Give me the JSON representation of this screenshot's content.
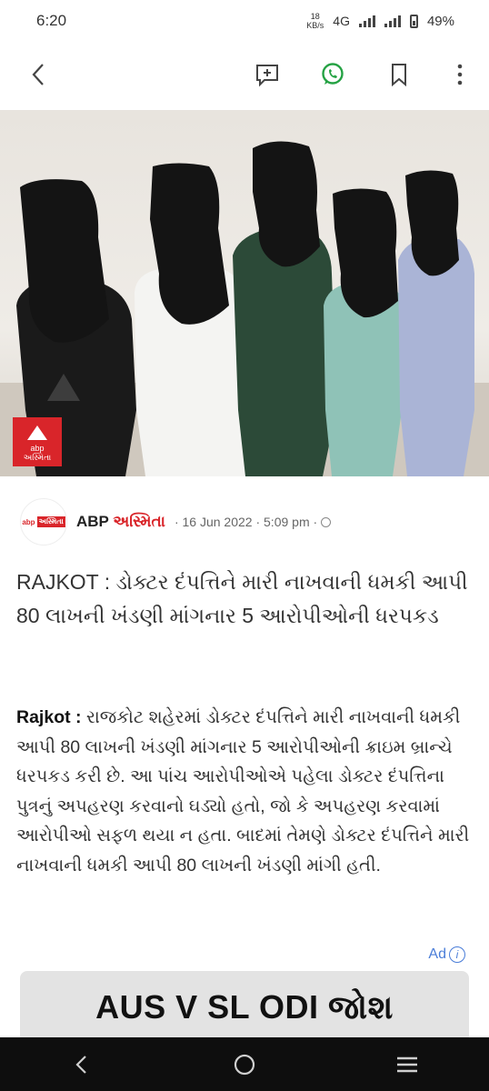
{
  "status_bar": {
    "time": "6:20",
    "net_speed_value": "18",
    "net_speed_unit": "KB/s",
    "network": "4G",
    "battery": "49%"
  },
  "toolbar": {
    "icons": [
      "back-icon",
      "add-comment-icon",
      "whatsapp-icon",
      "bookmark-icon",
      "more-icon"
    ]
  },
  "hero": {
    "badge_line1": "abp",
    "badge_line2": "અસ્મિતા"
  },
  "byline": {
    "logo_text": "abp",
    "logo_box": "અસ્મિતા",
    "publisher_prefix": "ABP ",
    "publisher_suffix": "અસ્મિતા",
    "date": "· 16 Jun 2022 · 5:09 pm ·"
  },
  "article": {
    "headline": "RAJKOT : ડોક્ટર દંપત્તિને મારી નાખવાની ધમકી આપી 80 લાખની ખંડણી માંગનાર 5 આરોપીઓની ધરપકડ",
    "body_lead": "Rajkot :",
    "body": " રાજકોટ શહેરમાં ડોક્ટર દંપત્તિને મારી નાખવાની ધમકી આપી 80 લાખની ખંડણી માંગનાર 5 આરોપીઓની ક્રાઇમ બ્રાન્ચે ધરપકડ કરી છે. આ પાંચ આરોપીઓએ પહેલા ડોક્ટર દંપત્તિના પુત્રનું અપહરણ કરવાનો ઘડ્યો હતો, જો કે અપહરણ કરવામાં આરોપીઓ સફળ થયા ન હતા. બાદમાં તેમણે ડોક્ટર દંપત્તિને મારી નાખવાની ધમકી આપી 80 લાખની ખંડણી માંગી હતી."
  },
  "ad": {
    "label": "Ad",
    "info": "i",
    "banner_text": "AUS V SL ODI જોશ"
  },
  "colors": {
    "accent_red": "#d9252a",
    "whatsapp_green": "#25a244",
    "ad_blue": "#4a7dd8"
  }
}
